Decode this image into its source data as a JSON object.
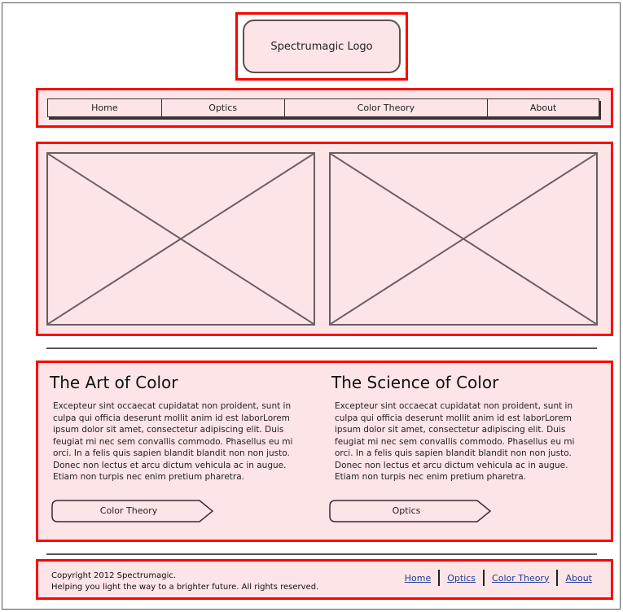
{
  "logo": {
    "text": "Spectrumagic Logo"
  },
  "nav": {
    "items": [
      {
        "label": "Home"
      },
      {
        "label": "Optics"
      },
      {
        "label": "Color Theory"
      },
      {
        "label": "About"
      }
    ]
  },
  "content": {
    "left": {
      "title": "The Art of Color",
      "body": "Excepteur sint occaecat cupidatat non proident, sunt in culpa qui officia deserunt mollit anim id est laborLorem ipsum dolor sit amet, consectetur adipiscing elit. Duis feugiat mi nec sem convallis commodo. Phasellus eu mi orci. In a felis quis sapien blandit blandit non non justo. Donec non lectus et arcu dictum vehicula ac in augue. Etiam non turpis nec enim pretium pharetra.",
      "button_label": "Color Theory"
    },
    "right": {
      "title": "The Science of Color",
      "body": "Excepteur sint occaecat cupidatat non proident, sunt in culpa qui officia deserunt mollit anim id est laborLorem ipsum dolor sit amet, consectetur adipiscing elit. Duis feugiat mi nec sem convallis commodo. Phasellus eu mi orci. In a felis quis sapien blandit blandit non non justo. Donec non lectus et arcu dictum vehicula ac in augue. Etiam non turpis nec enim pretium pharetra.",
      "button_label": "Optics"
    }
  },
  "footer": {
    "line1": "Copyright 2012 Spectrumagic.",
    "line2": "Helping you light the way to a brighter future. All rights reserved.",
    "links": [
      {
        "label": "Home"
      },
      {
        "label": "Optics"
      },
      {
        "label": "Color Theory"
      },
      {
        "label": "About"
      }
    ]
  },
  "colors": {
    "highlight_border": "#ff0000",
    "panel_fill": "#fde4e6",
    "link": "#1f3b9c"
  }
}
